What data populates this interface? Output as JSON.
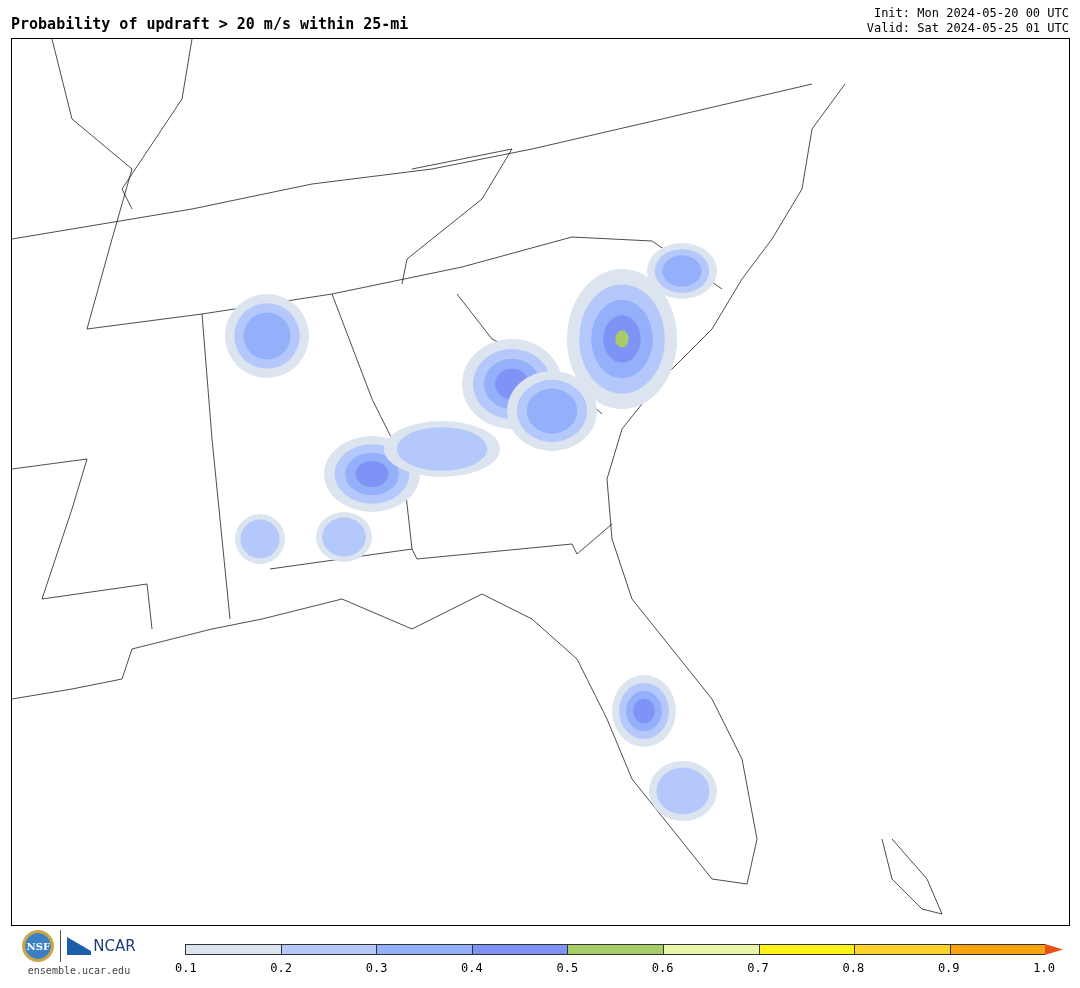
{
  "title": "Probability of updraft > 20 m/s within 25-mi",
  "init": "Init: Mon 2024-05-20 00 UTC",
  "valid": "Valid: Sat 2024-05-25 01 UTC",
  "logos": {
    "nsf": "NSF",
    "ncar": "NCAR",
    "url": "ensemble.ucar.edu"
  },
  "colorbar": {
    "segments": [
      {
        "color": "#dbe4ef"
      },
      {
        "color": "#b4c8fb"
      },
      {
        "color": "#94b0fa"
      },
      {
        "color": "#7f93f6"
      },
      {
        "color": "#a8cd68"
      },
      {
        "color": "#e9f5a8"
      },
      {
        "color": "#fff21a"
      },
      {
        "color": "#fdd22a"
      },
      {
        "color": "#fba30c"
      },
      {
        "color": "#e8501a",
        "kind": "arrow"
      }
    ],
    "ticks": [
      "0.1",
      "0.2",
      "0.3",
      "0.4",
      "0.5",
      "0.6",
      "0.7",
      "0.8",
      "0.9",
      "1.0"
    ]
  }
}
